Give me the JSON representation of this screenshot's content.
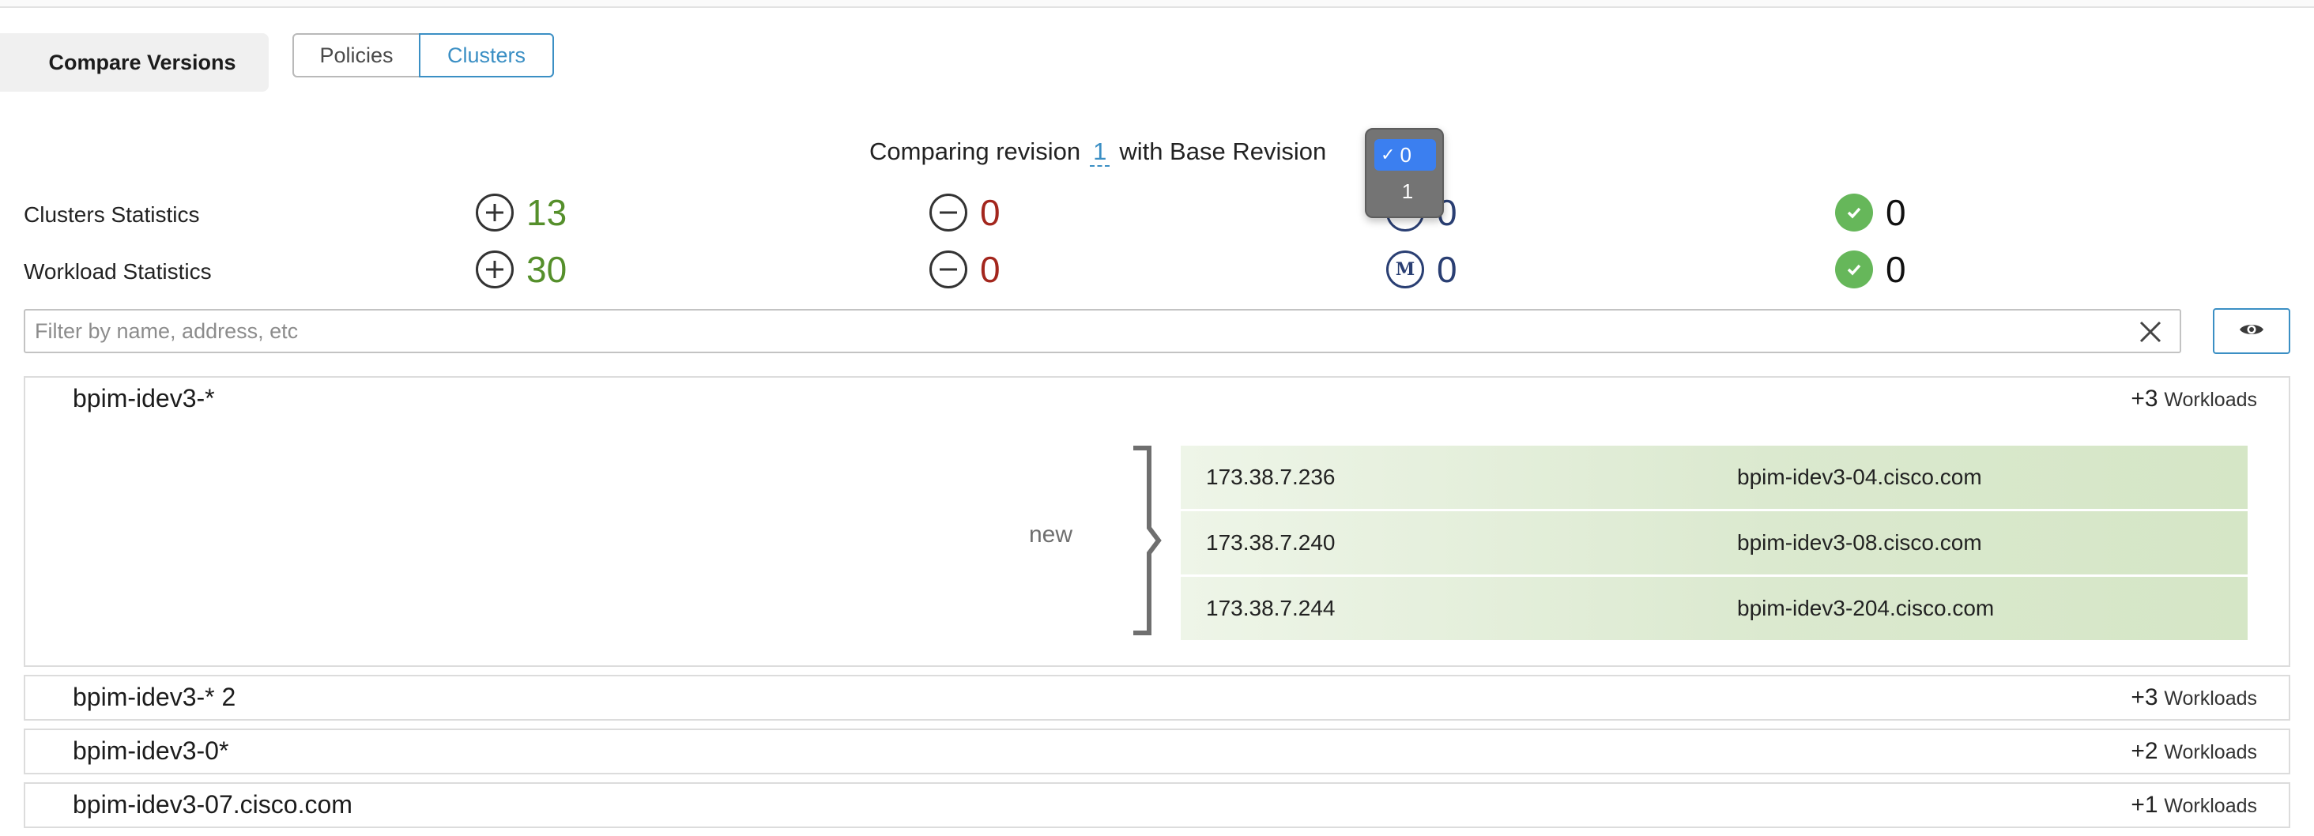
{
  "header": {
    "compare_label": "Compare Versions",
    "tabs": [
      {
        "label": "Policies",
        "active": false
      },
      {
        "label": "Clusters",
        "active": true
      }
    ]
  },
  "comparison": {
    "prefix": "Comparing revision",
    "revision": "1",
    "middle": "with Base Revision",
    "dropdown": {
      "selected": "0",
      "options": [
        "0",
        "1"
      ],
      "check_mark": "✓"
    }
  },
  "stats": {
    "clusters": {
      "label": "Clusters Statistics",
      "added": "13",
      "removed": "0",
      "modified": "0",
      "unchanged": "0",
      "modified_icon_letter": "M"
    },
    "workloads": {
      "label": "Workload Statistics",
      "added": "30",
      "removed": "0",
      "modified": "0",
      "unchanged": "0",
      "modified_icon_letter": "M"
    }
  },
  "filter": {
    "placeholder": "Filter by name, address, etc",
    "value": ""
  },
  "clusters": [
    {
      "name": "bpim-idev3-*",
      "count": "+3",
      "count_label": "Workloads",
      "expanded": true,
      "group_label": "new",
      "workloads": [
        {
          "ip": "173.38.7.236",
          "host": "bpim-idev3-04.cisco.com"
        },
        {
          "ip": "173.38.7.240",
          "host": "bpim-idev3-08.cisco.com"
        },
        {
          "ip": "173.38.7.244",
          "host": "bpim-idev3-204.cisco.com"
        }
      ]
    },
    {
      "name": "bpim-idev3-* 2",
      "count": "+3",
      "count_label": "Workloads",
      "expanded": false
    },
    {
      "name": "bpim-idev3-0*",
      "count": "+2",
      "count_label": "Workloads",
      "expanded": false
    },
    {
      "name": "bpim-idev3-07.cisco.com",
      "count": "+1",
      "count_label": "Workloads",
      "expanded": false
    }
  ],
  "colors": {
    "accent": "#3b8fc4",
    "added": "#558f2b",
    "removed": "#a3261d",
    "modified": "#2a3f73",
    "ok": "#66b75a",
    "row_green": "#d5e6c6"
  },
  "icons": {
    "added": "plus-circle-icon",
    "removed": "minus-circle-icon",
    "modified": "modified-m-icon",
    "unchanged": "check-circle-icon",
    "clear": "close-icon",
    "visibility": "eye-icon",
    "group": "bracket-icon"
  }
}
